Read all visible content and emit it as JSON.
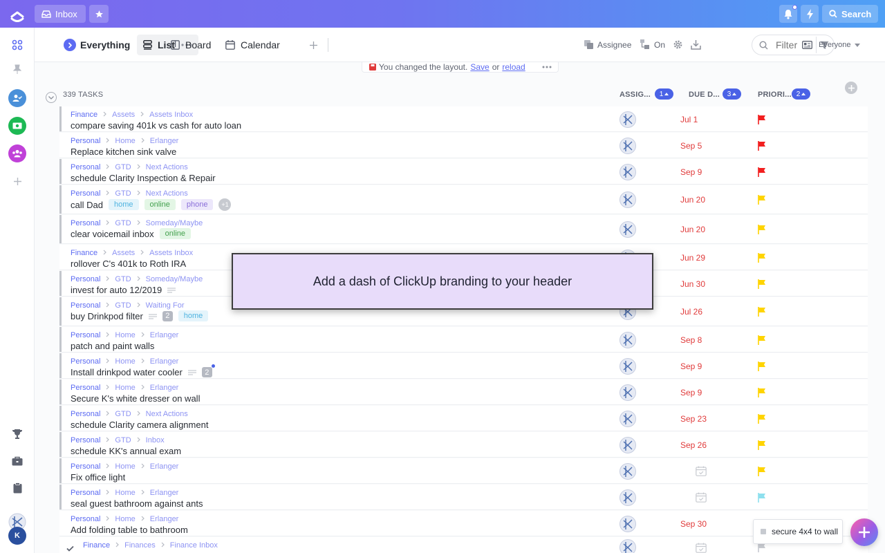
{
  "topbar": {
    "inbox_label": "Inbox",
    "search_label": "Search"
  },
  "viewbar": {
    "space_label": "Everything",
    "tabs": [
      {
        "label": "List"
      },
      {
        "label": "Board"
      },
      {
        "label": "Calendar"
      }
    ],
    "assignee_label": "Assignee",
    "on_label": "On",
    "filter_placeholder": "Filter",
    "everyone_label": "Everyone"
  },
  "banner": {
    "text": "You changed the layout.",
    "save_label": "Save",
    "or_label": "or",
    "reload_label": "reload"
  },
  "list_header": {
    "task_count": "339 TASKS",
    "assignee_col": "ASSIG...",
    "assignee_sort": "1",
    "due_col": "DUE D...",
    "due_sort": "3",
    "priority_col": "PRIORI...",
    "priority_sort": "2"
  },
  "colors": {
    "flag_red": "#f21f1f",
    "flag_yellow": "#ffd400",
    "flag_lightblue": "#8ee0ee",
    "accent": "#5c6bf2",
    "due_red": "#e03a3a"
  },
  "rows": [
    {
      "crumbs": [
        "Finance",
        "Assets",
        "Assets Inbox"
      ],
      "title": "compare saving 401k vs cash for auto loan",
      "due": "Jul 1",
      "flag": "red"
    },
    {
      "crumbs": [
        "Personal",
        "Home",
        "Erlanger"
      ],
      "title": "Replace kitchen sink valve",
      "due": "Sep 5",
      "flag": "red"
    },
    {
      "crumbs": [
        "Personal",
        "GTD",
        "Next Actions"
      ],
      "title": "schedule Clarity Inspection & Repair",
      "due": "Sep 9",
      "flag": "red"
    },
    {
      "crumbs": [
        "Personal",
        "GTD",
        "Next Actions"
      ],
      "title": "call Dad",
      "tags": [
        "home",
        "online",
        "phone"
      ],
      "more": "+1",
      "due": "Jun 20",
      "flag": "yellow"
    },
    {
      "crumbs": [
        "Personal",
        "GTD",
        "Someday/Maybe"
      ],
      "title": "clear voicemail inbox",
      "tags": [
        "online"
      ],
      "due": "Jun 20",
      "flag": "yellow"
    },
    {
      "crumbs": [
        "Finance",
        "Assets",
        "Assets Inbox"
      ],
      "title": "rollover C's 401k to Roth IRA",
      "due": "Jun 29",
      "flag": "yellow"
    },
    {
      "crumbs": [
        "Personal",
        "GTD",
        "Someday/Maybe"
      ],
      "title": "invest for auto 12/2019",
      "desc": true,
      "due": "Jun 30",
      "flag": "yellow"
    },
    {
      "crumbs": [
        "Personal",
        "GTD",
        "Waiting For"
      ],
      "title": "buy Drinkpod filter",
      "desc": true,
      "count": "2",
      "tags": [
        "home"
      ],
      "due": "Jul 26",
      "flag": "yellow"
    },
    {
      "crumbs": [
        "Personal",
        "Home",
        "Erlanger"
      ],
      "title": "patch and paint walls",
      "due": "Sep 8",
      "flag": "yellow"
    },
    {
      "crumbs": [
        "Personal",
        "Home",
        "Erlanger"
      ],
      "title": "Install drinkpod water cooler",
      "desc": true,
      "count": "2",
      "count_dot": true,
      "due": "Sep 9",
      "flag": "yellow"
    },
    {
      "crumbs": [
        "Personal",
        "Home",
        "Erlanger"
      ],
      "title": "Secure K's white dresser on wall",
      "due": "Sep 9",
      "flag": "yellow"
    },
    {
      "crumbs": [
        "Personal",
        "GTD",
        "Next Actions"
      ],
      "title": "schedule Clarity camera alignment",
      "due": "Sep 23",
      "flag": "yellow"
    },
    {
      "crumbs": [
        "Personal",
        "GTD",
        "Inbox"
      ],
      "title": "schedule KK's annual exam",
      "due": "Sep 26",
      "flag": "yellow"
    },
    {
      "crumbs": [
        "Personal",
        "Home",
        "Erlanger"
      ],
      "title": "Fix office light",
      "due": "",
      "flag": "yellow"
    },
    {
      "crumbs": [
        "Personal",
        "Home",
        "Erlanger"
      ],
      "title": "seal guest bathroom against ants",
      "due": "",
      "flag": "lightblue"
    },
    {
      "crumbs": [
        "Personal",
        "Home",
        "Erlanger"
      ],
      "title": "Add folding table to bathroom",
      "due": "Sep 30",
      "flag": "none"
    },
    {
      "crumbs": [
        "Finance",
        "Finances",
        "Finance Inbox"
      ],
      "title": "",
      "due": "",
      "flag": "gray",
      "checked": true
    }
  ],
  "overlay": {
    "text": "Add a dash of ClickUp branding to your header"
  },
  "bottom_task": {
    "text": "secure 4x4 to wall"
  },
  "user": {
    "initial": "K"
  }
}
